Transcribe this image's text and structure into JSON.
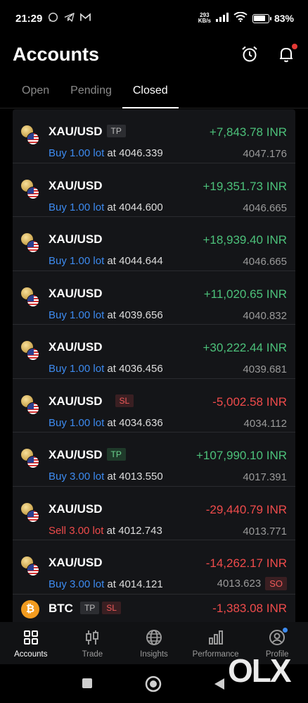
{
  "status_bar": {
    "time": "21:29",
    "net_speed_top": "293",
    "net_speed_bottom": "KB/s",
    "battery_pct": "83%"
  },
  "header": {
    "title": "Accounts",
    "icons": [
      "alarm-clock-icon",
      "bell-icon"
    ]
  },
  "tabs": [
    {
      "label": "Open",
      "active": false
    },
    {
      "label": "Pending",
      "active": false
    },
    {
      "label": "Closed",
      "active": true
    }
  ],
  "trades": [
    {
      "symbol": "XAU/USD",
      "badge": "TP",
      "side": "Buy",
      "lots": "1.00 lot",
      "at": "at",
      "open_price": "4046.339",
      "pnl": "+7,843.78 INR",
      "close_price": "4047.176"
    },
    {
      "symbol": "XAU/USD",
      "badge": "",
      "side": "Buy",
      "lots": "1.00 lot",
      "at": "at",
      "open_price": "4044.600",
      "pnl": "+19,351.73 INR",
      "close_price": "4046.665"
    },
    {
      "symbol": "XAU/USD",
      "badge": "",
      "side": "Buy",
      "lots": "1.00 lot",
      "at": "at",
      "open_price": "4044.644",
      "pnl": "+18,939.40 INR",
      "close_price": "4046.665"
    },
    {
      "symbol": "XAU/USD",
      "badge": "",
      "side": "Buy",
      "lots": "1.00 lot",
      "at": "at",
      "open_price": "4039.656",
      "pnl": "+11,020.65 INR",
      "close_price": "4040.832"
    },
    {
      "symbol": "XAU/USD",
      "badge": "",
      "side": "Buy",
      "lots": "1.00 lot",
      "at": "at",
      "open_price": "4036.456",
      "pnl": "+30,222.44 INR",
      "close_price": "4039.681"
    },
    {
      "symbol": "XAU/USD",
      "badge": "SL",
      "side": "Buy",
      "lots": "1.00 lot",
      "at": "at",
      "open_price": "4034.636",
      "pnl": "-5,002.58 INR",
      "close_price": "4034.112"
    },
    {
      "symbol": "XAU/USD",
      "badge": "TP",
      "side": "Buy",
      "lots": "3.00 lot",
      "at": "at",
      "open_price": "4013.550",
      "pnl": "+107,990.10 INR",
      "close_price": "4017.391"
    },
    {
      "symbol": "XAU/USD",
      "badge": "",
      "side": "Sell",
      "lots": "3.00 lot",
      "at": "at",
      "open_price": "4012.743",
      "pnl": "-29,440.79 INR",
      "close_price": "4013.771"
    },
    {
      "symbol": "XAU/USD",
      "badge": "",
      "side": "Buy",
      "lots": "3.00 lot",
      "at": "at",
      "open_price": "4014.121",
      "pnl": "-14,262.17 INR",
      "close_price": "4013.623",
      "close_badge": "SO"
    },
    {
      "symbol": "BTC",
      "badge_tp": "TP",
      "badge_sl": "SL",
      "pnl": "-1,383.08 INR"
    }
  ],
  "bottom_nav": [
    {
      "label": "Accounts",
      "icon": "grid-icon",
      "active": true
    },
    {
      "label": "Trade",
      "icon": "candlestick-icon",
      "active": false
    },
    {
      "label": "Insights",
      "icon": "globe-icon",
      "active": false
    },
    {
      "label": "Performance",
      "icon": "bar-chart-icon",
      "active": false
    },
    {
      "label": "Profile",
      "icon": "user-icon",
      "active": false
    }
  ],
  "watermark": "OLX",
  "colors": {
    "positive": "#4cc17a",
    "negative": "#ef4b4b",
    "buy": "#3d8bf0",
    "sell": "#ef4b4b"
  }
}
